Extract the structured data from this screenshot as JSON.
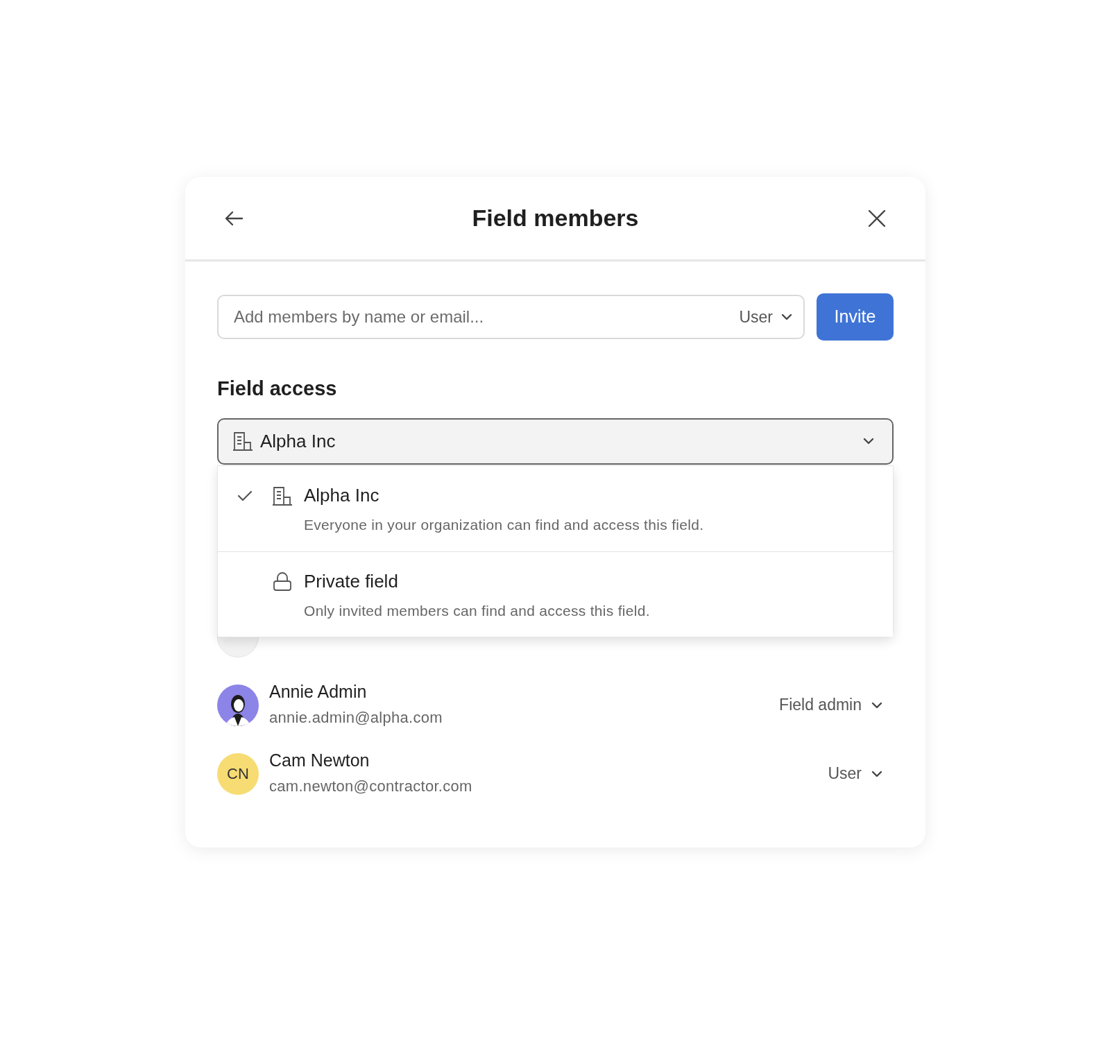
{
  "dialog": {
    "title": "Field members"
  },
  "invite": {
    "placeholder": "Add members by name or email...",
    "role": "User",
    "button": "Invite"
  },
  "access": {
    "heading": "Field access",
    "value": "Alpha Inc",
    "expanded": true,
    "options": [
      {
        "kind": "organization",
        "label": "Alpha Inc",
        "description": "Everyone in your organization can find and access this field.",
        "selected": true
      },
      {
        "kind": "private",
        "label": "Private field",
        "description": "Only invited members can find and access this field.",
        "selected": false
      }
    ]
  },
  "members": [
    {
      "kind": "group"
    },
    {
      "kind": "photo",
      "color": "#8d84e8",
      "name": "Annie Admin",
      "email": "annie.admin@alpha.com",
      "role": "Field admin"
    },
    {
      "kind": "initials",
      "color": "#f6dc72",
      "initials": "CN",
      "name": "Cam Newton",
      "email": "cam.newton@contractor.com",
      "role": "User"
    }
  ]
}
